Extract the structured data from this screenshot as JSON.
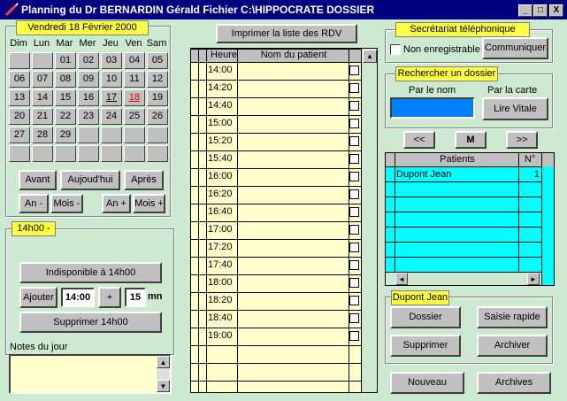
{
  "window": {
    "title": "Planning du Dr BERNARDIN Gérald  Fichier C:\\HIPPOCRATE DOSSIER",
    "min": "_",
    "max": "□",
    "close": "X"
  },
  "calendar": {
    "date_label": "Vendredi 18 Février 2000",
    "weekdays": [
      "Dim",
      "Lun",
      "Mar",
      "Mer",
      "Jeu",
      "Ven",
      "Sam"
    ],
    "weeks": [
      [
        "",
        "",
        "01",
        "02",
        "03",
        "04",
        "05"
      ],
      [
        "06",
        "07",
        "08",
        "09",
        "10",
        "11",
        "12"
      ],
      [
        "13",
        "14",
        "15",
        "16",
        "17",
        "18",
        "19"
      ],
      [
        "20",
        "21",
        "22",
        "23",
        "24",
        "25",
        "26"
      ],
      [
        "27",
        "28",
        "29",
        "",
        "",
        "",
        ""
      ],
      [
        "",
        "",
        "",
        "",
        "",
        "",
        ""
      ]
    ],
    "today": "18",
    "underlined": [
      "17",
      "18"
    ],
    "today_color": "#e00000",
    "nav": {
      "prev": "Avant",
      "today": "Aujoud'hui",
      "next": "Après",
      "year_minus": "An -",
      "month_minus": "Mois -",
      "year_plus": "An +",
      "month_plus": "Mois +"
    }
  },
  "slot": {
    "label": "14h00 -",
    "unavailable": "Indisponible à 14h00",
    "add": "Ajouter",
    "time_value": "14:00",
    "plus": "+",
    "duration": "15",
    "unit": "mn",
    "delete": "Supprimer 14h00"
  },
  "notes": {
    "label": "Notes du jour",
    "value": ""
  },
  "print_button": "Imprimer la liste des RDV",
  "schedule": {
    "col_hour": "Heure",
    "col_patient": "Nom du patient",
    "hours": [
      "14:00",
      "14:20",
      "14:40",
      "15:00",
      "15:20",
      "15:40",
      "16:00",
      "16:20",
      "16:40",
      "17:00",
      "17:20",
      "17:40",
      "18:00",
      "18:20",
      "18:40",
      "19:00"
    ]
  },
  "phone": {
    "label": "Secrétariat téléphonique",
    "non_record": "Non enregistrable",
    "communicate": "Communiquer"
  },
  "search": {
    "label": "Rechercher un dossier",
    "by_name": "Par le nom",
    "by_card": "Par la carte",
    "name_value": "",
    "read_card": "Lire Vitale"
  },
  "patient_nav": {
    "prev": "<<",
    "middle": "M",
    "next": ">>"
  },
  "patients": {
    "col_name": "Patients",
    "col_no": "N°",
    "rows": [
      {
        "name": "Dupont Jean",
        "no": "1"
      }
    ]
  },
  "selected": {
    "label": "Dupont Jean",
    "dossier": "Dossier",
    "quick": "Saisie rapide",
    "delete": "Supprimer",
    "archive": "Archiver"
  },
  "bottom": {
    "new": "Nouveau",
    "archives": "Archives"
  },
  "colors": {
    "client_bg": "#cde9cf",
    "titlebar": "#000080",
    "label_yellow": "#ffff44",
    "grid_yellow": "#ffffcc",
    "grid_cyan": "#00ffff",
    "input_blue": "#0080ff"
  }
}
